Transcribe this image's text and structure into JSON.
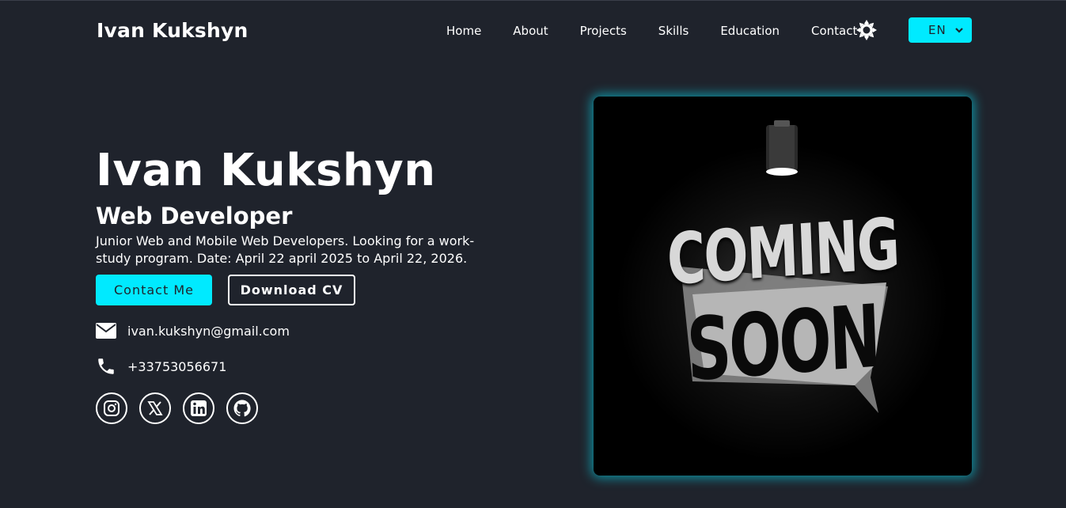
{
  "header": {
    "logo": "Ivan Kukshyn",
    "nav": [
      "Home",
      "About",
      "Projects",
      "Skills",
      "Education",
      "Contact"
    ],
    "language": "EN"
  },
  "hero": {
    "name": "Ivan Kukshyn",
    "role": "Web Developer",
    "description": "Junior Web and Mobile Web Developers. Looking for a work-study program. Date: April 22 april 2025 to April 22, 2026.",
    "contact_button": "Contact Me",
    "cv_button": "Download CV",
    "email": "ivan.kukshyn@gmail.com",
    "phone": "+33753056671",
    "socials": [
      "instagram-icon",
      "x-icon",
      "linkedin-icon",
      "github-icon"
    ]
  },
  "image": {
    "line1": "COMING",
    "line2": "SOON"
  },
  "colors": {
    "background": "#1f232c",
    "accent": "#00eaff",
    "text": "#ffffff"
  }
}
